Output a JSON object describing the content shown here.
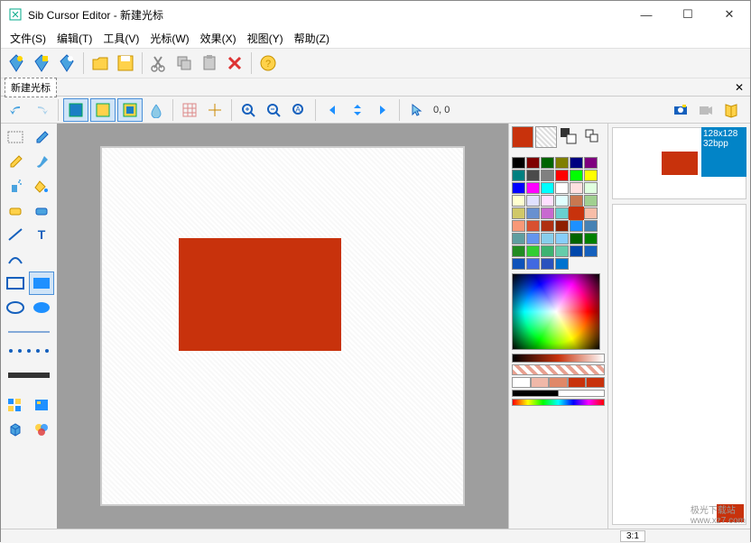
{
  "window": {
    "title": "Sib Cursor Editor - 新建光标",
    "minimize": "—",
    "maximize": "☐",
    "close": "✕"
  },
  "menu": {
    "file": "文件(S)",
    "edit": "编辑(T)",
    "tools": "工具(V)",
    "cursor": "光标(W)",
    "effects": "效果(X)",
    "view": "视图(Y)",
    "help": "帮助(Z)"
  },
  "tab": {
    "name": "新建光标",
    "close": "✕"
  },
  "coords": {
    "value": "0, 0"
  },
  "format": {
    "size": "128x128",
    "bpp": "32bpp"
  },
  "status": {
    "ratio": "3:1"
  },
  "watermark": {
    "site": "极光下载站",
    "url": "www.xz7.com"
  },
  "foreground_color": "#c8320c",
  "background_color_swatch": "repeating-linear-gradient(45deg,#ddd,#ddd 2px,#fff 2px,#fff 4px)",
  "palette_colors": [
    "#000000",
    "#7f0000",
    "#006400",
    "#7f7f00",
    "#000080",
    "#7f007f",
    "#008080",
    "#4b4b4b",
    "#808080",
    "#ff0000",
    "#00ff00",
    "#ffff00",
    "#0000ff",
    "#ff00ff",
    "#00ffff",
    "#ffffff",
    "#ffe0e0",
    "#e0ffe0",
    "#ffffd0",
    "#e0e0ff",
    "#ffe0ff",
    "#e0ffff",
    "#c87850",
    "#a0d090",
    "#d0c868",
    "#6890d0",
    "#c868d0",
    "#68d0d0",
    "#c8320c",
    "#f8bda8",
    "#f89878",
    "#d85030",
    "#b03010",
    "#8f2000",
    "#1e90ff",
    "#4682b4",
    "#5f9ea0",
    "#6495ed",
    "#87ceeb",
    "#87cefa",
    "#006400",
    "#008000",
    "#228b22",
    "#32cd32",
    "#3cb371",
    "#66cdaa",
    "#0047ab",
    "#1560bd",
    "#0f52ba",
    "#4169e1",
    "#2a52be",
    "#0073cf"
  ],
  "canvas": {
    "rect_color": "#c8320c"
  }
}
